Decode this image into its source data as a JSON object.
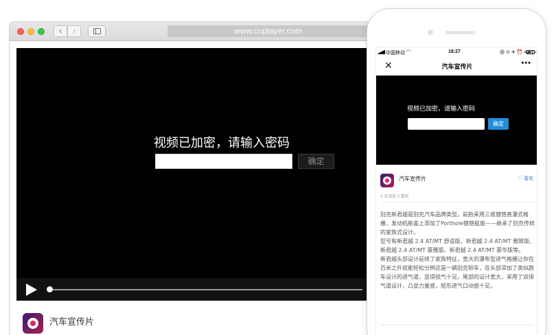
{
  "browser": {
    "url": "www.cuplayer.com",
    "nav_back": "‹",
    "nav_forward": "›"
  },
  "desktop_player": {
    "lock_title": "视频已加密，请输入密码",
    "password_value": "",
    "confirm_label": "确定",
    "progress": 0
  },
  "desktop_channel": {
    "name": "汽车宣传片"
  },
  "phone": {
    "status": {
      "carrier": "中国移动",
      "time": "18:27",
      "icons": "@ ⊙ ✈ ⏰ 42%"
    },
    "header": {
      "close": "✕",
      "title": "汽车宣传片",
      "more": "•••"
    },
    "player": {
      "lock_title": "视频已加密，请输入密码",
      "password_value": "",
      "confirm_label": "确定"
    },
    "channel": {
      "name": "汽车宣传片",
      "like_icon": "♡",
      "like_label": "喜欢",
      "stats": "4 次浏览 0 喜欢"
    },
    "description": [
      "别克新君越是别克汽车品牌类型。前脸采用三维镀铬直瀑式格栅，发动机舱盖上添加了Porthole镀铬舷窗——继承了别克传统的家族式设计。",
      "型号有新君越 2.4 AT/MT 舒适版、新君越 2.4 AT/MT 雅致版、新君越 2.4 AT/MT 豪雅版、新君越 2.4 AT/MT 豪华版等。",
      "新君越头部设计延续了家族特征，宽大的瀑布型进气格栅让你在百米之外就能轻松分辨这是一辆别克轿车，在头部添加了类似跑车设计的进气道，显得锐气十足。尾部的设计宽大，采用了双排气道设计，凸显力量感，矩形进气口动感十足。"
    ]
  }
}
